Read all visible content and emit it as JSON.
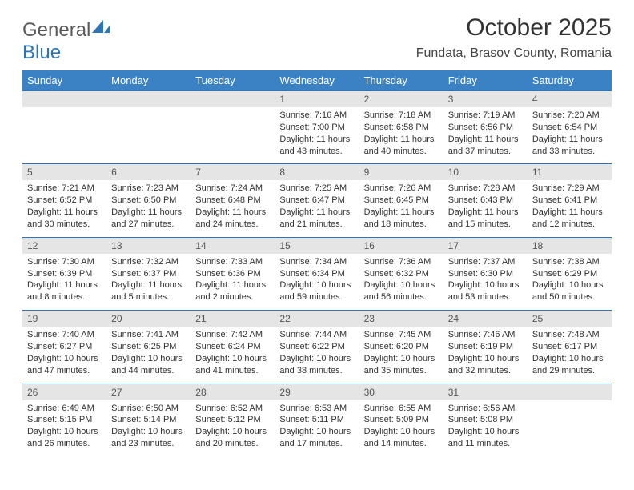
{
  "brand": {
    "part1": "General",
    "part2": "Blue"
  },
  "title": "October 2025",
  "location": "Fundata, Brasov County, Romania",
  "weekdays": [
    "Sunday",
    "Monday",
    "Tuesday",
    "Wednesday",
    "Thursday",
    "Friday",
    "Saturday"
  ],
  "weeks": [
    [
      null,
      null,
      null,
      {
        "n": "1",
        "sr": "7:16 AM",
        "ss": "7:00 PM",
        "dh": "11",
        "dm": "43"
      },
      {
        "n": "2",
        "sr": "7:18 AM",
        "ss": "6:58 PM",
        "dh": "11",
        "dm": "40"
      },
      {
        "n": "3",
        "sr": "7:19 AM",
        "ss": "6:56 PM",
        "dh": "11",
        "dm": "37"
      },
      {
        "n": "4",
        "sr": "7:20 AM",
        "ss": "6:54 PM",
        "dh": "11",
        "dm": "33"
      }
    ],
    [
      {
        "n": "5",
        "sr": "7:21 AM",
        "ss": "6:52 PM",
        "dh": "11",
        "dm": "30"
      },
      {
        "n": "6",
        "sr": "7:23 AM",
        "ss": "6:50 PM",
        "dh": "11",
        "dm": "27"
      },
      {
        "n": "7",
        "sr": "7:24 AM",
        "ss": "6:48 PM",
        "dh": "11",
        "dm": "24"
      },
      {
        "n": "8",
        "sr": "7:25 AM",
        "ss": "6:47 PM",
        "dh": "11",
        "dm": "21"
      },
      {
        "n": "9",
        "sr": "7:26 AM",
        "ss": "6:45 PM",
        "dh": "11",
        "dm": "18"
      },
      {
        "n": "10",
        "sr": "7:28 AM",
        "ss": "6:43 PM",
        "dh": "11",
        "dm": "15"
      },
      {
        "n": "11",
        "sr": "7:29 AM",
        "ss": "6:41 PM",
        "dh": "11",
        "dm": "12"
      }
    ],
    [
      {
        "n": "12",
        "sr": "7:30 AM",
        "ss": "6:39 PM",
        "dh": "11",
        "dm": "8"
      },
      {
        "n": "13",
        "sr": "7:32 AM",
        "ss": "6:37 PM",
        "dh": "11",
        "dm": "5"
      },
      {
        "n": "14",
        "sr": "7:33 AM",
        "ss": "6:36 PM",
        "dh": "11",
        "dm": "2"
      },
      {
        "n": "15",
        "sr": "7:34 AM",
        "ss": "6:34 PM",
        "dh": "10",
        "dm": "59"
      },
      {
        "n": "16",
        "sr": "7:36 AM",
        "ss": "6:32 PM",
        "dh": "10",
        "dm": "56"
      },
      {
        "n": "17",
        "sr": "7:37 AM",
        "ss": "6:30 PM",
        "dh": "10",
        "dm": "53"
      },
      {
        "n": "18",
        "sr": "7:38 AM",
        "ss": "6:29 PM",
        "dh": "10",
        "dm": "50"
      }
    ],
    [
      {
        "n": "19",
        "sr": "7:40 AM",
        "ss": "6:27 PM",
        "dh": "10",
        "dm": "47"
      },
      {
        "n": "20",
        "sr": "7:41 AM",
        "ss": "6:25 PM",
        "dh": "10",
        "dm": "44"
      },
      {
        "n": "21",
        "sr": "7:42 AM",
        "ss": "6:24 PM",
        "dh": "10",
        "dm": "41"
      },
      {
        "n": "22",
        "sr": "7:44 AM",
        "ss": "6:22 PM",
        "dh": "10",
        "dm": "38"
      },
      {
        "n": "23",
        "sr": "7:45 AM",
        "ss": "6:20 PM",
        "dh": "10",
        "dm": "35"
      },
      {
        "n": "24",
        "sr": "7:46 AM",
        "ss": "6:19 PM",
        "dh": "10",
        "dm": "32"
      },
      {
        "n": "25",
        "sr": "7:48 AM",
        "ss": "6:17 PM",
        "dh": "10",
        "dm": "29"
      }
    ],
    [
      {
        "n": "26",
        "sr": "6:49 AM",
        "ss": "5:15 PM",
        "dh": "10",
        "dm": "26"
      },
      {
        "n": "27",
        "sr": "6:50 AM",
        "ss": "5:14 PM",
        "dh": "10",
        "dm": "23"
      },
      {
        "n": "28",
        "sr": "6:52 AM",
        "ss": "5:12 PM",
        "dh": "10",
        "dm": "20"
      },
      {
        "n": "29",
        "sr": "6:53 AM",
        "ss": "5:11 PM",
        "dh": "10",
        "dm": "17"
      },
      {
        "n": "30",
        "sr": "6:55 AM",
        "ss": "5:09 PM",
        "dh": "10",
        "dm": "14"
      },
      {
        "n": "31",
        "sr": "6:56 AM",
        "ss": "5:08 PM",
        "dh": "10",
        "dm": "11"
      },
      null
    ]
  ],
  "labels": {
    "sunrise": "Sunrise: ",
    "sunset": "Sunset: ",
    "daylight_pre": "Daylight: ",
    "hours": " hours",
    "and": "and ",
    "minutes": " minutes."
  }
}
